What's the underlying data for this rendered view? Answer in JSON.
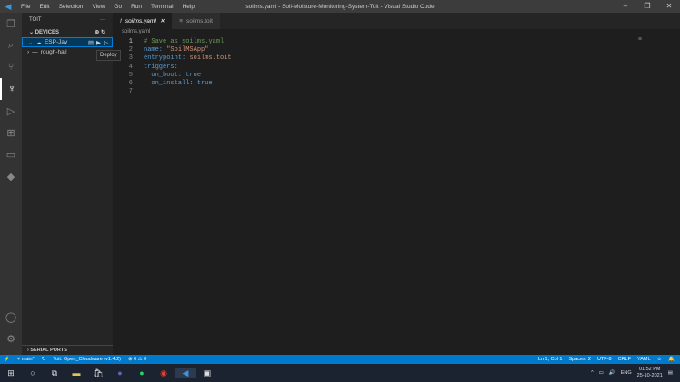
{
  "window": {
    "title": "soilms.yaml - Soil-Moisture-Monitoring-System-Toit - Visual Studio Code",
    "menu": [
      "File",
      "Edit",
      "Selection",
      "View",
      "Go",
      "Run",
      "Terminal",
      "Help"
    ]
  },
  "sidebar": {
    "title": "TOIT",
    "section": "DEVICES",
    "devices": [
      {
        "name": "ESP-Jay"
      },
      {
        "name": "rough-hall"
      }
    ],
    "tooltip": "Deploy",
    "footer": "SERIAL PORTS"
  },
  "tabs": [
    {
      "label": "soilms.yaml",
      "active": true
    },
    {
      "label": "soilms.toit",
      "active": false
    }
  ],
  "breadcrumb": "soilms.yaml",
  "code": [
    {
      "n": "1",
      "t": "# Save as soilms.yaml"
    },
    {
      "n": "2",
      "k": "name:",
      "v": " \"SoilMSApp\""
    },
    {
      "n": "3",
      "k": "entrypoint:",
      "v": " soilms.toit"
    },
    {
      "n": "4",
      "k": "triggers:",
      "v": ""
    },
    {
      "n": "5",
      "k": "  on_boot:",
      "v": " true"
    },
    {
      "n": "6",
      "k": "  on_install:",
      "v": " true"
    },
    {
      "n": "7",
      "t": ""
    }
  ],
  "status": {
    "branch": "main*",
    "toit": "Toit: Open_Cloudware (v1.4.2)",
    "problems": "⊗ 0 ⚠ 0",
    "position": "Ln 1, Col 1",
    "spaces": "Spaces: 2",
    "encoding": "UTF-8",
    "eol": "CRLF",
    "language": "YAML"
  },
  "taskbar": {
    "lang": "ENG",
    "time": "01:52 PM",
    "date": "25-10-2021"
  }
}
